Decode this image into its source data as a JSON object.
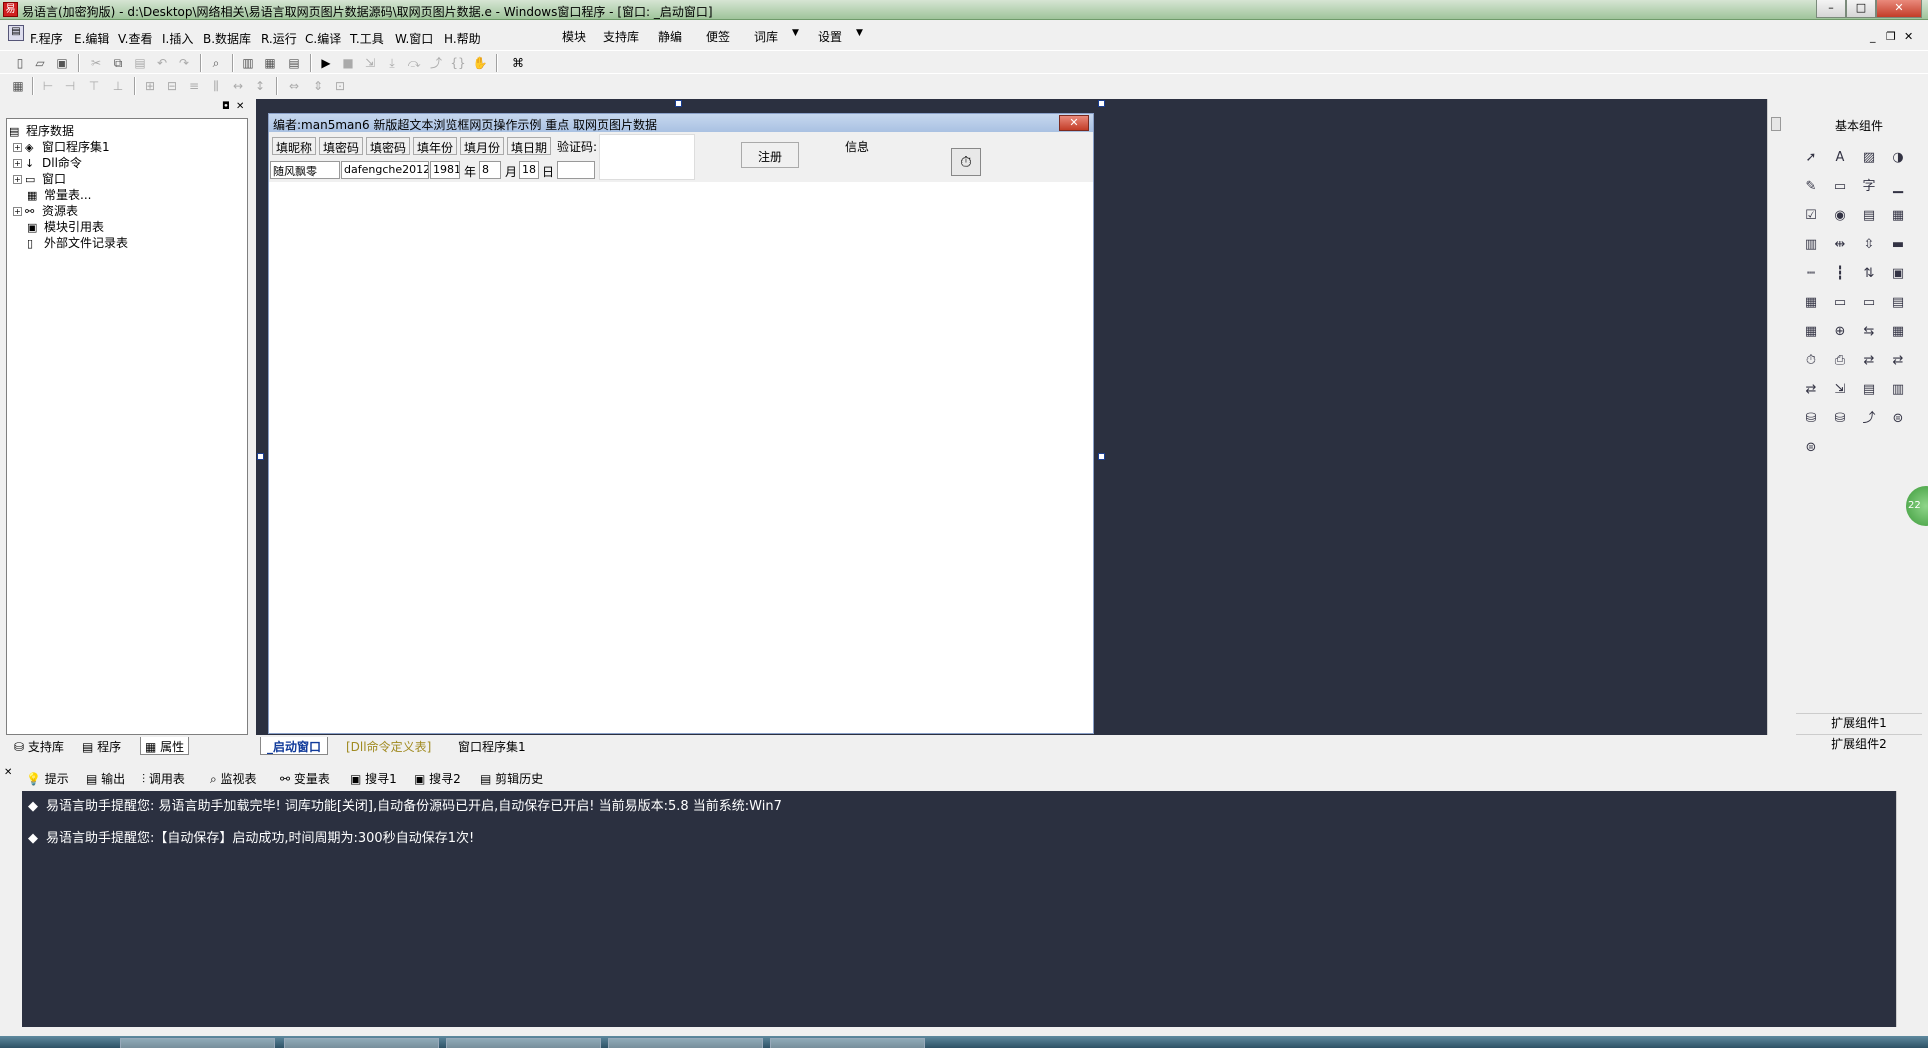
{
  "window": {
    "title": "易语言(加密狗版) - d:\\Desktop\\网络相关\\易语言取网页图片数据源码\\取网页图片数据.e - Windows窗口程序 - [窗口: _启动窗口]",
    "minimize": "–",
    "maximize": "□",
    "close": "✕"
  },
  "menu": {
    "items": [
      "F.程序",
      "E.编辑",
      "V.查看",
      "I.插入",
      "B.数据库",
      "R.运行",
      "C.编译",
      "T.工具",
      "W.窗口",
      "H.帮助"
    ],
    "right_items": [
      "模块",
      "支持库",
      "静编",
      "便签",
      "词库",
      "设置"
    ]
  },
  "tree": {
    "root": "程序数据",
    "items": [
      "窗口程序集1",
      "Dll命令",
      "窗口",
      "常量表...",
      "资源表",
      "模块引用表",
      "外部文件记录表"
    ]
  },
  "left_tabs": [
    "支持库",
    "程序",
    "属性"
  ],
  "form": {
    "caption": "编者:man5man6 新版超文本浏览框网页操作示例 重点 取网页图片数据",
    "buttons": [
      "填昵称",
      "填密码",
      "填密码",
      "填年份",
      "填月份",
      "填日期"
    ],
    "captcha_label": "验证码:",
    "register_button": "注册",
    "info_label": "信息",
    "nickname": "随风飘零",
    "password": "dafengche2012",
    "year": "1981",
    "year_unit": "年",
    "month": "8",
    "month_unit": "月",
    "day": "18",
    "day_unit": "日"
  },
  "doc_tabs": [
    "_启动窗口",
    "[Dll命令定义表]",
    "窗口程序集1"
  ],
  "palette": {
    "title": "基本组件",
    "ext1": "扩展组件1",
    "ext2": "扩展组件2",
    "icons": [
      "pointer-icon",
      "label-icon",
      "image-icon",
      "shape-icon",
      "edit-icon",
      "frame-icon",
      "text-icon",
      "line-icon",
      "checkbox-icon",
      "radio-icon",
      "listbox-icon",
      "grid-icon",
      "table-icon",
      "slider-icon",
      "scroll-icon",
      "progress-icon",
      "hscroll-icon",
      "vscroll-icon",
      "spin-icon",
      "tab-icon",
      "calendar-icon",
      "input-icon",
      "folder-icon",
      "doc-icon",
      "chart-icon",
      "globe-icon",
      "split-icon",
      "board-icon",
      "timer-icon",
      "printer-icon",
      "network-icon",
      "network2-icon",
      "client-icon",
      "port-icon",
      "panel-icon",
      "panel2-icon",
      "db-icon",
      "db2-icon",
      "graph-icon",
      "odbc-icon",
      "odbc2-icon"
    ]
  },
  "green_badge": "22",
  "output_tabs": [
    "提示",
    "输出",
    "调用表",
    "监视表",
    "变量表",
    "搜寻1",
    "搜寻2",
    "剪辑历史"
  ],
  "output": {
    "lines": [
      "易语言助手提醒您:  易语言助手加载完毕!  词库功能[关闭],自动备份源码已开启,自动保存已开启!  当前易版本:5.8  当前系统:Win7",
      "易语言助手提醒您:【自动保存】启动成功,时间周期为:300秒自动保存1次!"
    ]
  }
}
